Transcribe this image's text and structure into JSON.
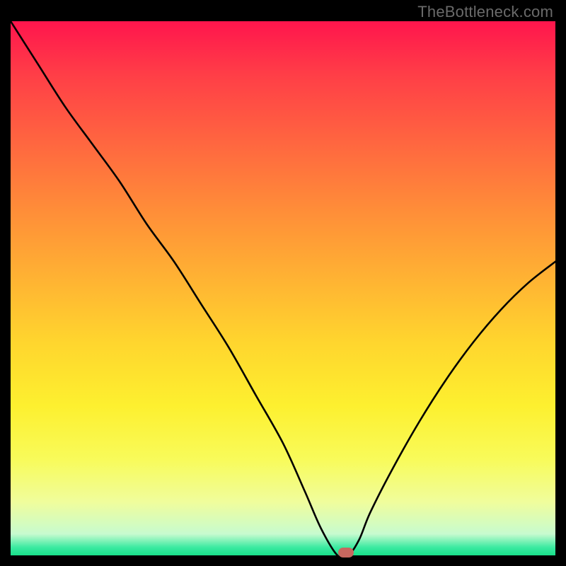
{
  "watermark": "TheBottleneck.com",
  "chart_data": {
    "type": "line",
    "title": "",
    "xlabel": "",
    "ylabel": "",
    "x": [
      0.0,
      0.05,
      0.1,
      0.15,
      0.2,
      0.25,
      0.3,
      0.35,
      0.4,
      0.45,
      0.5,
      0.54,
      0.57,
      0.6,
      0.62,
      0.64,
      0.66,
      0.7,
      0.75,
      0.8,
      0.85,
      0.9,
      0.95,
      1.0
    ],
    "values": [
      100,
      92,
      84,
      77,
      70,
      62,
      55,
      47,
      39,
      30,
      21,
      12,
      5,
      0,
      0,
      3,
      8,
      16,
      25,
      33,
      40,
      46,
      51,
      55
    ],
    "xlim": [
      0,
      1
    ],
    "ylim": [
      0,
      100
    ],
    "marker": {
      "x": 0.615,
      "y": 0.5
    },
    "gradient_stops": [
      {
        "pos": 0.0,
        "color": "#ff154d"
      },
      {
        "pos": 0.5,
        "color": "#ffc030"
      },
      {
        "pos": 0.8,
        "color": "#f8fb5a"
      },
      {
        "pos": 0.97,
        "color": "#c7fbcf"
      },
      {
        "pos": 1.0,
        "color": "#18e08a"
      }
    ]
  }
}
